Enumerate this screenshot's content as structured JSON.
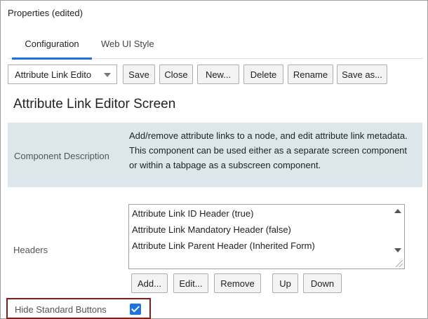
{
  "window": {
    "title": "Properties (edited)"
  },
  "tabs": [
    {
      "label": "Configuration",
      "active": true
    },
    {
      "label": "Web UI Style",
      "active": false
    }
  ],
  "toolbar": {
    "select_value": "Attribute Link Edito",
    "buttons": [
      "Save",
      "Close",
      "New...",
      "Delete",
      "Rename",
      "Save as..."
    ]
  },
  "screen_title": "Attribute Link Editor Screen",
  "component_description": {
    "label": "Component Description",
    "text": "Add/remove attribute links to a node, and edit attribute link metadata. This component can be used either as a separate screen component or within a tabpage as a subscreen component."
  },
  "headers": {
    "label": "Headers",
    "items": [
      "Attribute Link ID Header (true)",
      "Attribute Link Mandatory Header (false)",
      "Attribute Link Parent Header (Inherited Form)"
    ],
    "buttons": [
      "Add...",
      "Edit...",
      "Remove",
      "Up",
      "Down"
    ]
  },
  "hide_standard_buttons": {
    "label": "Hide Standard Buttons",
    "checked": true
  },
  "colors": {
    "accent": "#1a73e8",
    "description_bg": "#dce6eb",
    "highlight_border": "#8b1a1a"
  }
}
